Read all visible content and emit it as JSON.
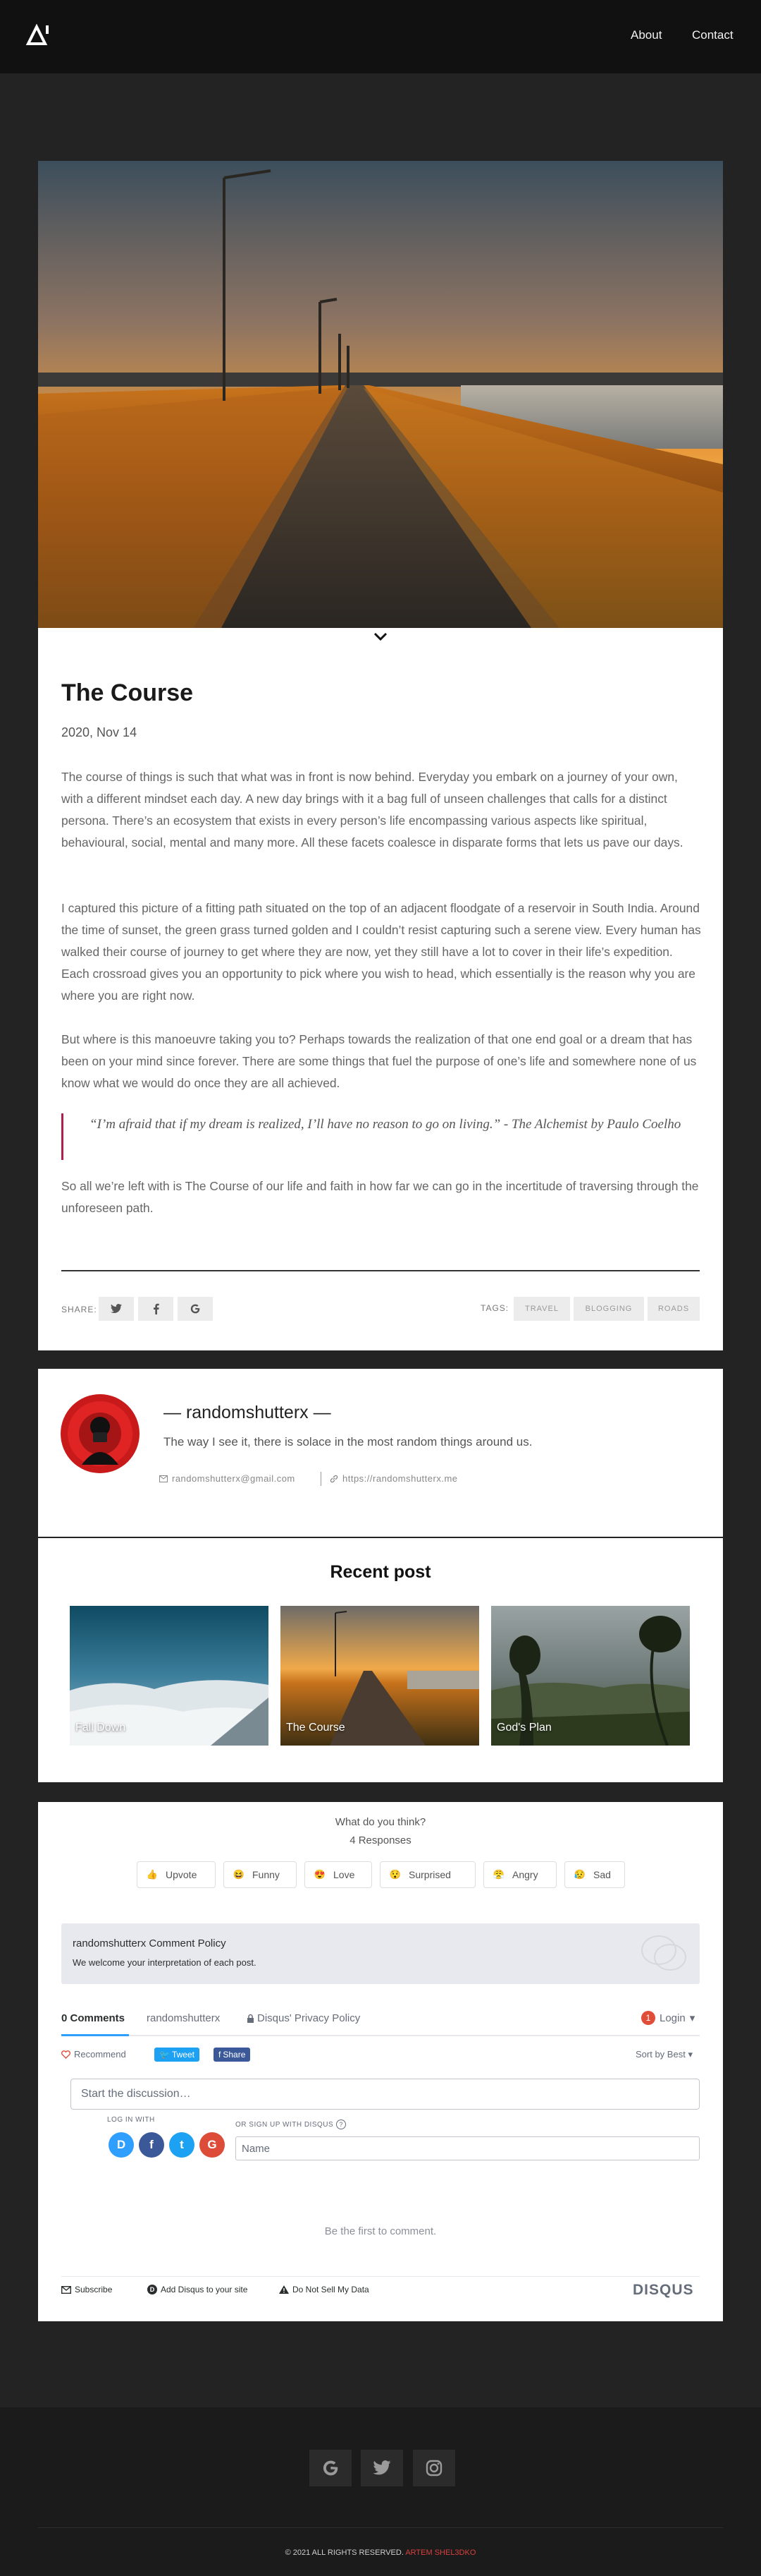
{
  "header": {
    "logo_icon": "site-logo-icon",
    "nav": [
      {
        "label": "About"
      },
      {
        "label": "Contact"
      }
    ]
  },
  "article": {
    "title": "The Course",
    "date": "2020, Nov 14",
    "paragraphs": [
      "The course of things is such that what was in front is now behind. Everyday you embark on a journey of your own, with a different mindset each day. A new day brings with it a bag full of unseen challenges that calls for a distinct persona. There’s an ecosystem that exists in every person’s life encompassing various aspects like spiritual, behavioural, social, mental and many more. All these facets coalesce in disparate forms that lets us pave our days.",
      "I captured this picture of a fitting path situated on the top of an adjacent floodgate of a reservoir in South India. Around the time of sunset, the green grass turned golden and I couldn’t resist capturing such a serene view. Every human has walked their course of journey to get where they are now, yet they still have a lot to cover in their life’s expedition. Each crossroad gives you an opportunity to pick where you wish to head, which essentially is the reason why you are where you are right now.",
      "But where is this manoeuvre taking you to? Perhaps towards the realization of that one end goal or a dream that has been on your mind since forever. There are some things that fuel the purpose of one’s life and somewhere none of us know what we would do once they are all achieved.",
      "So all we’re left with is The Course of our life and faith in how far we can go in the incertitude of traversing through the unforeseen path."
    ],
    "quote": "“I’m afraid that if my dream is realized, I’ll have no reason to go on living.” - The Alchemist by Paulo Coelho",
    "share_label": "SHARE:",
    "tags_label": "TAGS:",
    "tags": [
      "TRAVEL",
      "BLOGGING",
      "ROADS"
    ]
  },
  "author": {
    "name": "— randomshutterx —",
    "bio": "The way I see it, there is solace in the most random things around us.",
    "email": "randomshutterx@gmail.com",
    "website": "https://randomshutterx.me"
  },
  "recent": {
    "title": "Recent post",
    "posts": [
      {
        "label": "Fall Down"
      },
      {
        "label": "The Course"
      },
      {
        "label": "God's Plan"
      }
    ]
  },
  "disqus": {
    "question": "What do you think?",
    "responses": "4 Responses",
    "reactions": [
      {
        "label": "Upvote",
        "emoji": "👍"
      },
      {
        "label": "Funny",
        "emoji": "😆"
      },
      {
        "label": "Love",
        "emoji": "😍"
      },
      {
        "label": "Surprised",
        "emoji": "😯"
      },
      {
        "label": "Angry",
        "emoji": "😤"
      },
      {
        "label": "Sad",
        "emoji": "😥"
      }
    ],
    "policy_title": "randomshutterx Comment Policy",
    "policy_text": "We welcome your interpretation of each post.",
    "tab_comments": "0 Comments",
    "tab_forum": "randomshutterx",
    "tab_privacy": "Disqus' Privacy Policy",
    "login": "Login",
    "recommend": "Recommend",
    "tweet": "Tweet",
    "share": "Share",
    "sort": "Sort by Best",
    "start_placeholder": "Start the discussion…",
    "log_in_with": "LOG IN WITH",
    "signup": "OR SIGN UP WITH DISQUS",
    "name_placeholder": "Name",
    "empty_text": "Be the first to comment.",
    "footer_subscribe": "Subscribe",
    "footer_add": "Add Disqus to your site",
    "footer_sell": "Do Not Sell My Data",
    "brand": "DISQUS"
  },
  "footer": {
    "copyright": "© 2021 ALL RIGHTS RESERVED.",
    "author": "ARTEM SHEL3DKO"
  },
  "colors": {
    "page_bg": "#232323",
    "header_bg": "#111111",
    "quote_accent": "#b01e4b",
    "disqus_blue": "#2e9fff",
    "footer_author": "#d7403f"
  }
}
